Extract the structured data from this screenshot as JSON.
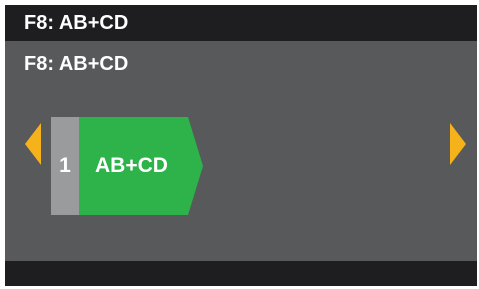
{
  "header": {
    "title": "F8: AB+CD"
  },
  "main": {
    "subtitle": "F8: AB+CD",
    "step": {
      "number": "1",
      "label": "AB+CD",
      "color": "#2db34a",
      "number_bg": "#9a9b9d"
    },
    "nav": {
      "prev_icon": "arrow-left-icon",
      "next_icon": "arrow-right-icon",
      "arrow_color": "#f6b21b"
    }
  },
  "colors": {
    "background": "#58595b",
    "bar": "#1e1d1f",
    "text": "#ffffff"
  }
}
